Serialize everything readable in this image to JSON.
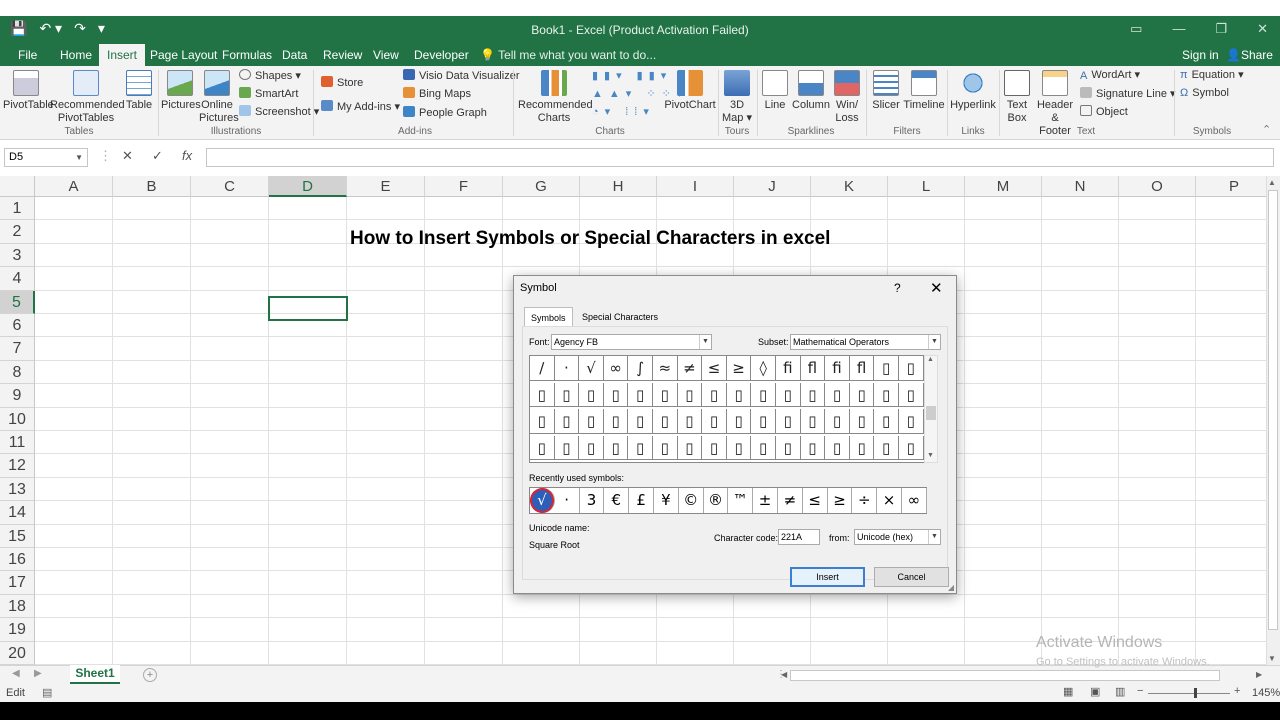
{
  "window": {
    "title": "Book1 - Excel (Product Activation Failed)",
    "qat": [
      "💾",
      "↶ ▾",
      "↷",
      "▾"
    ],
    "controls": [
      "▭",
      "—",
      "❐",
      "✕"
    ]
  },
  "tabs": [
    "File",
    "Home",
    "Insert",
    "Page Layout",
    "Formulas",
    "Data",
    "Review",
    "View",
    "Developer"
  ],
  "active_tab": "Insert",
  "tell_me": "Tell me what you want to do...",
  "sign_in": "Sign in",
  "share": "Share",
  "ribbon": {
    "tables": {
      "pivottable": "PivotTable",
      "recommended_1": "Recommended",
      "recommended_2": "PivotTables",
      "table": "Table",
      "group": "Tables"
    },
    "illustrations": {
      "pictures": "Pictures",
      "online_1": "Online",
      "online_2": "Pictures",
      "shapes": "Shapes ▾",
      "smartart": "SmartArt",
      "screenshot": "Screenshot ▾",
      "group": "Illustrations"
    },
    "addins": {
      "store": "Store",
      "myaddins": "My Add-ins ▾",
      "visio": "Visio Data Visualizer",
      "bing": "Bing Maps",
      "people": "People Graph",
      "group": "Add-ins"
    },
    "charts": {
      "rec_1": "Recommended",
      "rec_2": "Charts",
      "pivotchart": "PivotChart",
      "group": "Charts"
    },
    "tours": {
      "map_1": "3D",
      "map_2": "Map ▾",
      "group": "Tours"
    },
    "sparklines": {
      "line": "Line",
      "column": "Column",
      "winloss_1": "Win/",
      "winloss_2": "Loss",
      "group": "Sparklines"
    },
    "filters": {
      "slicer": "Slicer",
      "timeline": "Timeline",
      "group": "Filters"
    },
    "links": {
      "hyperlink": "Hyperlink",
      "group": "Links"
    },
    "text": {
      "textbox_1": "Text",
      "textbox_2": "Box",
      "header_1": "Header",
      "header_2": "& Footer",
      "wordart": "WordArt ▾",
      "signature": "Signature Line ▾",
      "object": "Object",
      "group": "Text"
    },
    "symbols": {
      "equation": "Equation ▾",
      "symbol": "Symbol",
      "group": "Symbols"
    }
  },
  "formula_bar": {
    "name_box": "D5",
    "cancel": "✕",
    "enter": "✓",
    "fx": "fx",
    "value": ""
  },
  "columns": [
    "A",
    "B",
    "C",
    "D",
    "E",
    "F",
    "G",
    "H",
    "I",
    "J",
    "K",
    "L",
    "M",
    "N",
    "O",
    "P"
  ],
  "rows": [
    "1",
    "2",
    "3",
    "4",
    "5",
    "6",
    "7",
    "8",
    "9",
    "10",
    "11",
    "12",
    "13",
    "14",
    "15",
    "16",
    "17",
    "18",
    "19",
    "20"
  ],
  "selected_cell": "D5",
  "heading": "How to Insert Symbols or Special Characters in excel",
  "sheet": {
    "name": "Sheet1",
    "add": "+"
  },
  "status": {
    "mode": "Edit",
    "zoom": "145%"
  },
  "activation": {
    "line1": "Activate Windows",
    "line2": "Go to Settings to activate Windows."
  },
  "dialog": {
    "title": "Symbol",
    "help": "?",
    "close": "✕",
    "tabs": [
      "Symbols",
      "Special Characters"
    ],
    "font_label": "Font:",
    "font_value": "Agency FB",
    "subset_label": "Subset:",
    "subset_value": "Mathematical Operators",
    "grid": [
      [
        "∕",
        "·",
        "√",
        "∞",
        "∫",
        "≈",
        "≠",
        "≤",
        "≥",
        "◊",
        "ﬁ",
        "ﬂ",
        "ﬁ",
        "ﬂ",
        "▯",
        "▯"
      ],
      [
        "▯",
        "▯",
        "▯",
        "▯",
        "▯",
        "▯",
        "▯",
        "▯",
        "▯",
        "▯",
        "▯",
        "▯",
        "▯",
        "▯",
        "▯",
        "▯"
      ],
      [
        "▯",
        "▯",
        "▯",
        "▯",
        "▯",
        "▯",
        "▯",
        "▯",
        "▯",
        "▯",
        "▯",
        "▯",
        "▯",
        "▯",
        "▯",
        "▯"
      ],
      [
        "▯",
        "▯",
        "▯",
        "▯",
        "▯",
        "▯",
        "▯",
        "▯",
        "▯",
        "▯",
        "▯",
        "▯",
        "▯",
        "▯",
        "▯",
        "▯"
      ]
    ],
    "recent_label": "Recently used symbols:",
    "recent": [
      "√",
      "·",
      "3",
      "€",
      "£",
      "¥",
      "©",
      "®",
      "™",
      "±",
      "≠",
      "≤",
      "≥",
      "÷",
      "×",
      "∞"
    ],
    "unicode_name_label": "Unicode name:",
    "unicode_name": "Square Root",
    "char_code_label": "Character code:",
    "char_code": "221A",
    "from_label": "from:",
    "from_value": "Unicode (hex)",
    "insert": "Insert",
    "cancel": "Cancel"
  }
}
